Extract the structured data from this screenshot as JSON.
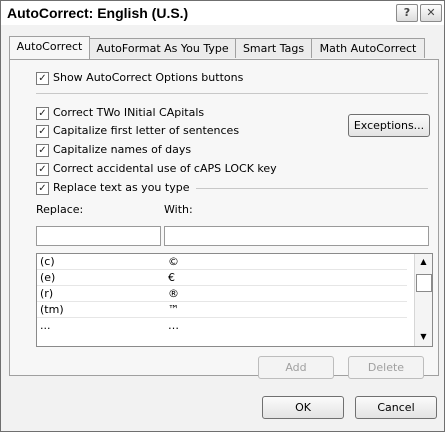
{
  "window": {
    "title": "AutoCorrect: English (U.S.)",
    "help_glyph": "?",
    "close_glyph": "✕"
  },
  "tabs": [
    {
      "label": "AutoCorrect",
      "active": true
    },
    {
      "label": "AutoFormat As You Type",
      "active": false
    },
    {
      "label": "Smart Tags",
      "active": false
    },
    {
      "label": "Math AutoCorrect",
      "active": false
    }
  ],
  "options": {
    "show_buttons": {
      "label": "Show AutoCorrect Options buttons",
      "checked": true
    },
    "two_initial": {
      "label": "Correct TWo INitial CApitals",
      "checked": true
    },
    "capitalize_sentences": {
      "label": "Capitalize first letter of sentences",
      "checked": true
    },
    "capitalize_days": {
      "label": "Capitalize names of days",
      "checked": true
    },
    "caps_lock": {
      "label": "Correct accidental use of cAPS LOCK key",
      "checked": true
    },
    "replace_text": {
      "label": "Replace text as you type",
      "checked": true
    }
  },
  "check_glyph": "✓",
  "exceptions_button": "Exceptions...",
  "replace": {
    "replace_label": "Replace:",
    "with_label": "With:",
    "replace_value": "",
    "with_value": ""
  },
  "entries": [
    {
      "replace": "(c)",
      "with": "©"
    },
    {
      "replace": "(e)",
      "with": "€"
    },
    {
      "replace": "(r)",
      "with": "®"
    },
    {
      "replace": "(tm)",
      "with": "™"
    },
    {
      "replace": "...",
      "with": "…"
    }
  ],
  "scroll": {
    "up_glyph": "▲",
    "down_glyph": "▼"
  },
  "add_button": "Add",
  "delete_button": "Delete",
  "ok_button": "OK",
  "cancel_button": "Cancel"
}
